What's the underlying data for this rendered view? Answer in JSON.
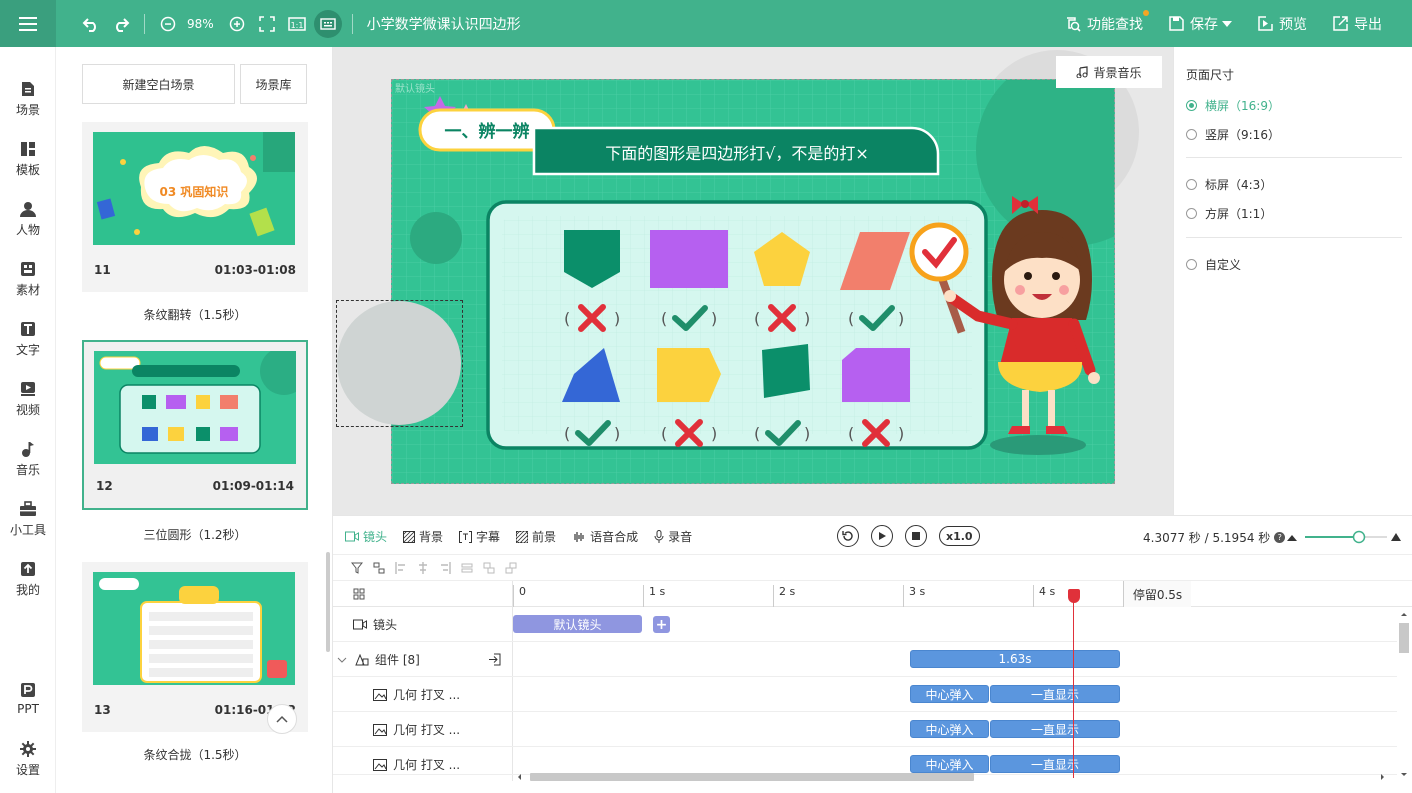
{
  "topbar": {
    "zoom": "98%",
    "title": "小学数学微课认识四边形",
    "search": "功能查找",
    "save": "保存",
    "preview": "预览",
    "export": "导出"
  },
  "nav": [
    "场景",
    "模板",
    "人物",
    "素材",
    "文字",
    "视频",
    "音乐",
    "小工具",
    "我的",
    "PPT",
    "设置"
  ],
  "scenes": {
    "new_blank": "新建空白场景",
    "library": "场景库",
    "cards": [
      {
        "no": "11",
        "time": "01:03-01:08",
        "transition": "条纹翻转（1.5秒）",
        "thumb_text": "03 巩固知识"
      },
      {
        "no": "12",
        "time": "01:09-01:14",
        "transition": "三位圆形（1.2秒）"
      },
      {
        "no": "13",
        "time": "01:16-01:22",
        "transition": "条纹合拢（1.5秒）"
      }
    ]
  },
  "stage": {
    "label": "默认镜头",
    "badge": "一、辨一辨",
    "question": "下面的图形是四边形打√，不是的打×",
    "bgm": "背景音乐",
    "shapes": [
      {
        "shape": "pentagon-shield",
        "color": "#0b8f6a",
        "mark": "cross"
      },
      {
        "shape": "rectangle",
        "color": "#b660f0",
        "mark": "check"
      },
      {
        "shape": "pentagon",
        "color": "#fcd23e",
        "mark": "cross"
      },
      {
        "shape": "parallelogram",
        "color": "#f27f6c",
        "mark": "check"
      },
      {
        "shape": "quad",
        "color": "#3467d6",
        "mark": "check"
      },
      {
        "shape": "arrow-pentagon",
        "color": "#fcd23e",
        "mark": "cross"
      },
      {
        "shape": "square-rotated",
        "color": "#0b8f6a",
        "mark": "check"
      },
      {
        "shape": "hexagon",
        "color": "#b660f0",
        "mark": "cross"
      }
    ],
    "colors": {
      "stage": "#33c394",
      "board": "#d5f7ef",
      "board_border": "#0b8463",
      "cross": "#e1303a",
      "check": "#1f8e6a"
    }
  },
  "props": {
    "title": "页面尺寸",
    "opts": [
      "横屏（16:9）",
      "竖屏（9:16）",
      "标屏（4:3）",
      "方屏（1:1）",
      "自定义"
    ]
  },
  "timeline": {
    "tabs": [
      "镜头",
      "背景",
      "字幕",
      "前景",
      "语音合成",
      "录音"
    ],
    "speed": "x1.0",
    "time": "4.3077 秒 / 5.1954 秒",
    "ticks": [
      "0",
      "1 s",
      "2 s",
      "3 s",
      "4 s"
    ],
    "pause": "停留0.5s",
    "tracks": [
      {
        "label": "镜头",
        "clips": [
          "默认镜头"
        ]
      },
      {
        "label": "组件 [8]",
        "clips": [
          "1.63s"
        ]
      },
      {
        "label": "几何 打叉 ...",
        "clips": [
          "中心弹入",
          "一直显示"
        ]
      },
      {
        "label": "几何 打叉 ...",
        "clips": [
          "中心弹入",
          "一直显示"
        ]
      },
      {
        "label": "几何 打叉 ...",
        "clips": [
          "中心弹入",
          "一直显示"
        ]
      }
    ],
    "playhead_s": 4.3077
  }
}
